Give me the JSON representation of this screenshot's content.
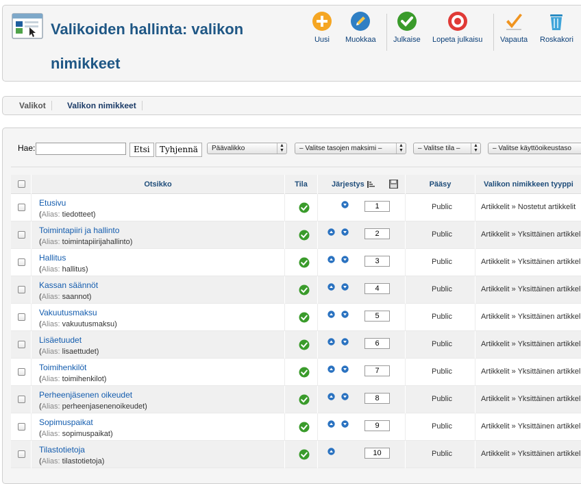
{
  "header": {
    "title": "Valikoiden hallinta: valikon nimikkeet",
    "icon": "menu-manager-icon",
    "toolbar": [
      {
        "key": "new",
        "label": "Uusi",
        "icon": "plus-icon",
        "color": "#f5a623"
      },
      {
        "key": "edit",
        "label": "Muokkaa",
        "icon": "pencil-icon",
        "color": "#2f7fc4"
      },
      {
        "key": "publish",
        "label": "Julkaise",
        "icon": "check-icon",
        "color": "#3a9b2b"
      },
      {
        "key": "unpublish",
        "label": "Lopeta julkaisu",
        "icon": "stop-icon",
        "color": "#e03a36"
      },
      {
        "key": "checkin",
        "label": "Vapauta",
        "icon": "checkmark-orange-icon",
        "color": "#f0941f"
      },
      {
        "key": "trash",
        "label": "Roskakori",
        "icon": "trash-icon",
        "color": "#3fa4d9"
      }
    ]
  },
  "submenu": {
    "tabs": [
      {
        "label": "Valikot",
        "active": false
      },
      {
        "label": "Valikon nimikkeet",
        "active": true
      }
    ]
  },
  "filters": {
    "search_label": "Hae:",
    "search_value": "",
    "search_button": "Etsi",
    "clear_button": "Tyhjennä",
    "menu_select": "Päävalikko",
    "levels_select": "– Valitse tasojen maksimi –",
    "state_select": "– Valitse tila –",
    "access_select": "– Valitse käyttöoikeustaso"
  },
  "table": {
    "columns": {
      "title": "Otsikko",
      "status": "Tila",
      "ordering": "Järjestys",
      "access": "Pääsy",
      "type": "Valikon nimikkeen tyyppi"
    },
    "alias_prefix": "Alias:",
    "rows": [
      {
        "title": "Etusivu",
        "alias": "tiedotteet",
        "order": "1",
        "access": "Public",
        "type": "Artikkelit » Nostetut artikkelit",
        "up": false,
        "down": true
      },
      {
        "title": "Toimintapiiri ja hallinto",
        "alias": "toimintapiirijahallinto",
        "order": "2",
        "access": "Public",
        "type": "Artikkelit » Yksittäinen artikkeli",
        "up": true,
        "down": true
      },
      {
        "title": "Hallitus",
        "alias": "hallitus",
        "order": "3",
        "access": "Public",
        "type": "Artikkelit » Yksittäinen artikkeli",
        "up": true,
        "down": true
      },
      {
        "title": "Kassan säännöt",
        "alias": "saannot",
        "order": "4",
        "access": "Public",
        "type": "Artikkelit » Yksittäinen artikkeli",
        "up": true,
        "down": true
      },
      {
        "title": "Vakuutusmaksu",
        "alias": "vakuutusmaksu",
        "order": "5",
        "access": "Public",
        "type": "Artikkelit » Yksittäinen artikkeli",
        "up": true,
        "down": true
      },
      {
        "title": "Lisäetuudet",
        "alias": "lisaettudet",
        "order": "6",
        "access": "Public",
        "type": "Artikkelit » Yksittäinen artikkeli",
        "up": true,
        "down": true
      },
      {
        "title": "Toimihenkilöt",
        "alias": "toimihenkilot",
        "order": "7",
        "access": "Public",
        "type": "Artikkelit » Yksittäinen artikkeli",
        "up": true,
        "down": true
      },
      {
        "title": "Perheenjäsenen oikeudet",
        "alias": "perheenjasenenoikeudet",
        "order": "8",
        "access": "Public",
        "type": "Artikkelit » Yksittäinen artikkeli",
        "up": true,
        "down": true
      },
      {
        "title": "Sopimuspaikat",
        "alias": "sopimuspaikat",
        "order": "9",
        "access": "Public",
        "type": "Artikkelit » Yksittäinen artikkeli",
        "up": true,
        "down": true
      },
      {
        "title": "Tilastotietoja",
        "alias": "tilastotietoja",
        "order": "10",
        "access": "Public",
        "type": "Artikkelit » Yksittäinen artikkeli",
        "up": true,
        "down": false
      }
    ]
  }
}
